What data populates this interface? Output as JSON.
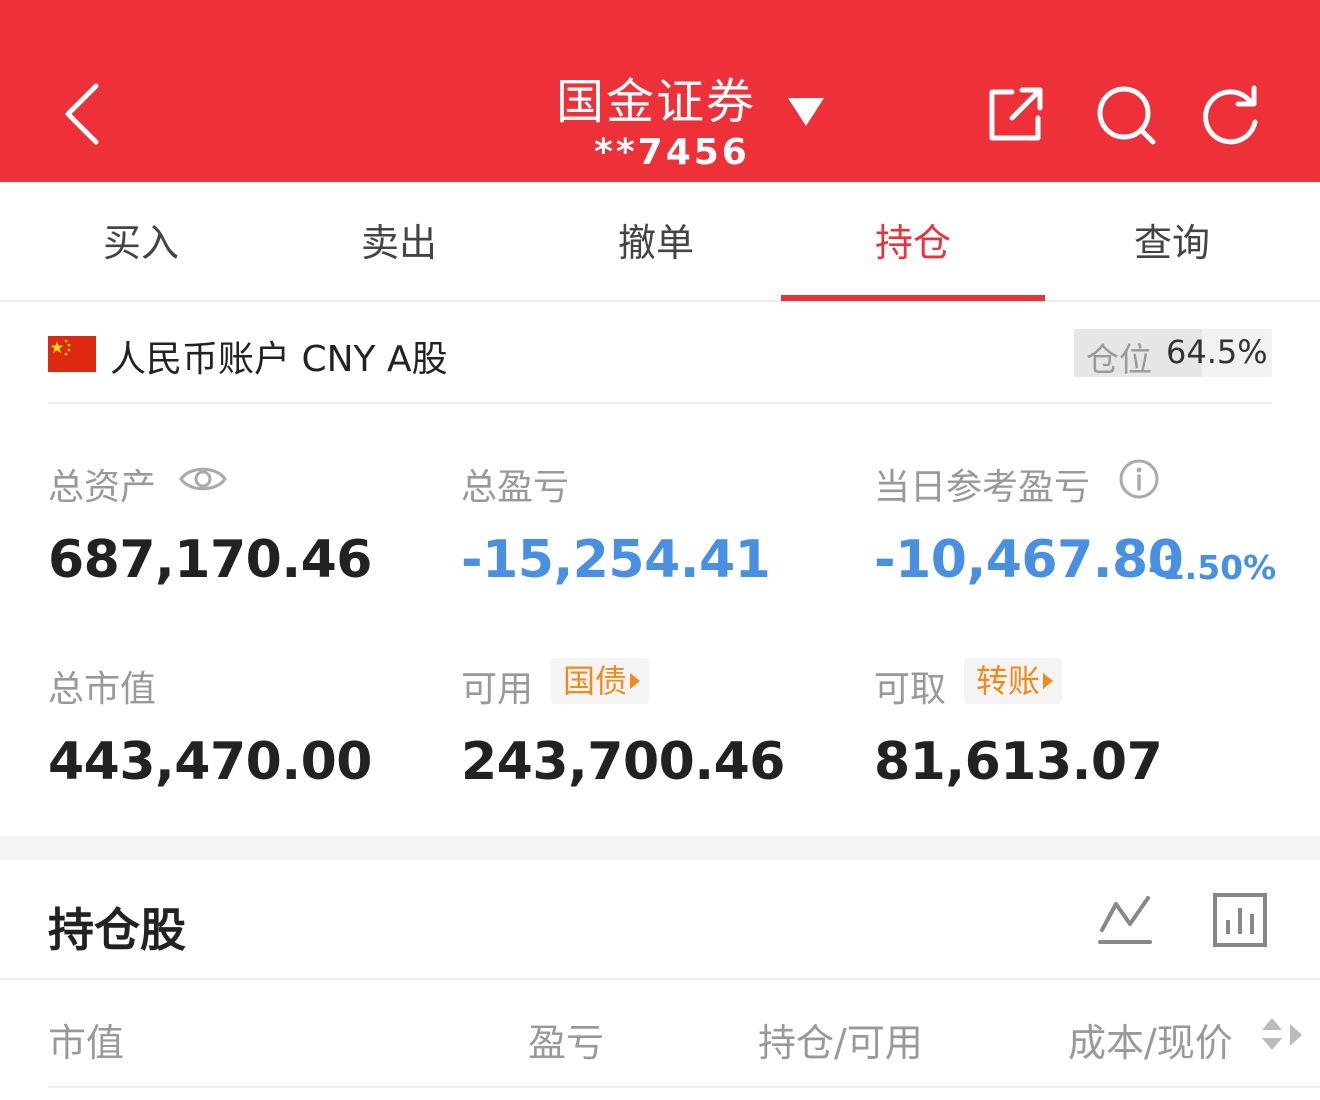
{
  "header": {
    "title": "国金证券",
    "account_masked": "**7456",
    "icons": [
      "back-icon",
      "dropdown-caret-icon",
      "share-icon",
      "search-icon",
      "refresh-icon"
    ],
    "background_color": "#ee3039"
  },
  "tabs": [
    {
      "label": "买入",
      "active": false
    },
    {
      "label": "卖出",
      "active": false
    },
    {
      "label": "撤单",
      "active": false
    },
    {
      "label": "持仓",
      "active": true
    },
    {
      "label": "查询",
      "active": false
    }
  ],
  "account": {
    "name": "人民币账户 CNY A股",
    "flag_icon": "china-flag-icon",
    "position_label": "仓位",
    "position_value": "64.5%",
    "position_fraction": 0.645
  },
  "metrics": {
    "total_assets": {
      "label": "总资产",
      "value": "687,170.46"
    },
    "total_pnl": {
      "label": "总盈亏",
      "value": "-15,254.41"
    },
    "daily_pnl": {
      "label": "当日参考盈亏",
      "value": "-10,467.80",
      "percent": "-1.50%"
    },
    "market_value": {
      "label": "总市值",
      "value": "443,470.00"
    },
    "available": {
      "label": "可用",
      "tag": "国债",
      "value": "243,700.46"
    },
    "withdrawable": {
      "label": "可取",
      "tag": "转账",
      "value": "81,613.07"
    }
  },
  "holdings": {
    "title": "持仓股",
    "columns": [
      "市值",
      "盈亏",
      "持仓/可用",
      "成本/现价"
    ]
  },
  "colors": {
    "accent_red": "#e5343c",
    "loss_blue": "#4a90e2",
    "tag_orange": "#f08a1c"
  }
}
